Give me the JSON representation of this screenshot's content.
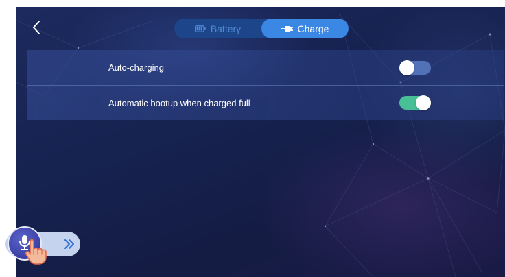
{
  "nav": {
    "back_icon": "chevron-left-icon"
  },
  "tabs": [
    {
      "label": "Battery",
      "icon": "battery-icon",
      "active": false
    },
    {
      "label": "Charge",
      "icon": "plug-icon",
      "active": true
    }
  ],
  "settings": [
    {
      "label": "Auto-charging",
      "enabled": false
    },
    {
      "label": "Automatic bootup when charged full",
      "enabled": true
    }
  ],
  "voice_assistant": {
    "mic_icon": "microphone-icon",
    "hand_icon": "pointing-hand-icon",
    "expand_icon": "double-chevron-right-icon"
  },
  "colors": {
    "background": "#162250",
    "tab_active": "#3a87e4",
    "tab_inactive_text": "#4f8ad6",
    "toggle_on": "#48bf95",
    "toggle_off": "#5272b8"
  }
}
